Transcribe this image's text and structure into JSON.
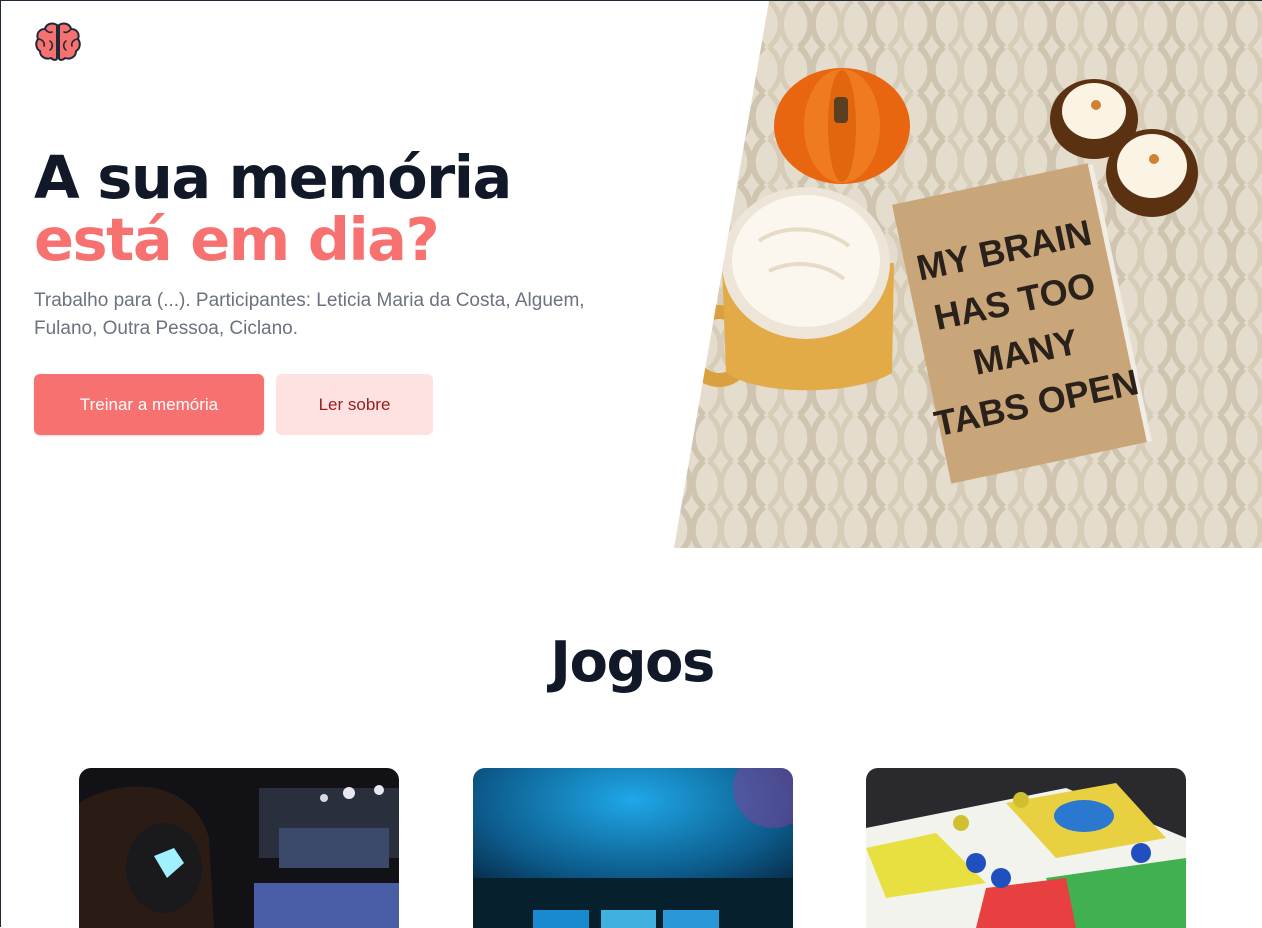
{
  "header": {
    "logo_icon": "brain-icon",
    "logo_color": "#f87171"
  },
  "hero": {
    "title_line1": "A sua memória",
    "title_line2": "está em dia?",
    "subtitle": "Trabalho para (...). Participantes: Leticia Maria da Costa, Alguem, Fulano, Outra Pessoa, Ciclano.",
    "primary_button": "Treinar a memória",
    "secondary_button": "Ler sobre",
    "image_notebook_text": [
      "MY BRAIN",
      "HAS TOO",
      "MANY",
      "TABS OPEN"
    ]
  },
  "games": {
    "title": "Jogos",
    "cards": [
      {
        "image": "gamer-headset-photo"
      },
      {
        "image": "arcade-blue-photo"
      },
      {
        "image": "ludo-board-photo"
      }
    ]
  },
  "colors": {
    "accent": "#f87171",
    "accent_light": "#fee2e2",
    "heading": "#111827",
    "muted": "#6b7280"
  }
}
